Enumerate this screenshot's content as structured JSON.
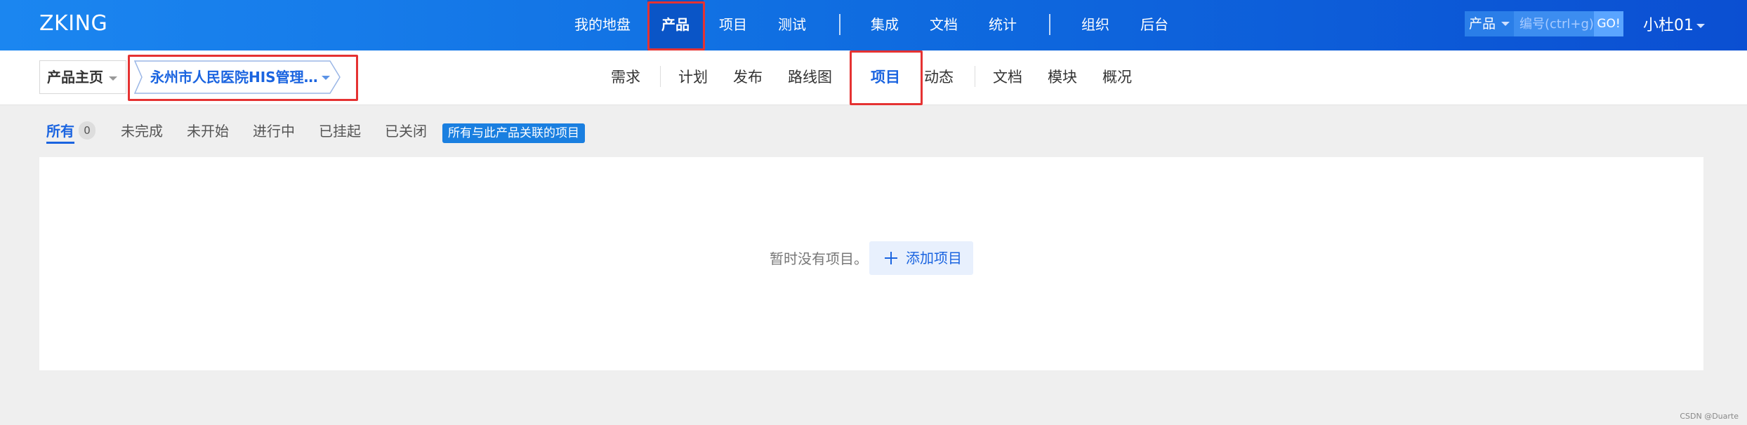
{
  "header": {
    "logo": "ZKING",
    "nav": [
      {
        "label": "我的地盘"
      },
      {
        "label": "产品",
        "active": true
      },
      {
        "label": "项目"
      },
      {
        "label": "测试"
      },
      {
        "label": "集成"
      },
      {
        "label": "文档"
      },
      {
        "label": "统计"
      },
      {
        "label": "组织"
      },
      {
        "label": "后台"
      }
    ],
    "search": {
      "category": "产品",
      "placeholder": "编号(ctrl+g)",
      "go_label": "GO!"
    },
    "user": "小杜01"
  },
  "subheader": {
    "home_label": "产品主页",
    "breadcrumb": "永州市人民医院HIS管理…",
    "nav": [
      {
        "label": "需求"
      },
      {
        "label": "计划"
      },
      {
        "label": "发布"
      },
      {
        "label": "路线图"
      },
      {
        "label": "项目",
        "active": true
      },
      {
        "label": "动态"
      },
      {
        "label": "文档"
      },
      {
        "label": "模块"
      },
      {
        "label": "概况"
      }
    ]
  },
  "filters": {
    "tabs": [
      {
        "label": "所有",
        "active": true
      },
      {
        "label": "未完成"
      },
      {
        "label": "未开始"
      },
      {
        "label": "进行中"
      },
      {
        "label": "已挂起"
      },
      {
        "label": "已关闭"
      }
    ],
    "all_count": "0",
    "tag": "所有与此产品关联的项目"
  },
  "main": {
    "empty_text": "暂时没有项目。",
    "add_label": "添加项目"
  },
  "watermark": "CSDN @Duarte",
  "colors": {
    "accent": "#1a64e0",
    "highlight": "#e53232",
    "header_start": "#1b86f0",
    "header_end": "#0b4fd2"
  }
}
